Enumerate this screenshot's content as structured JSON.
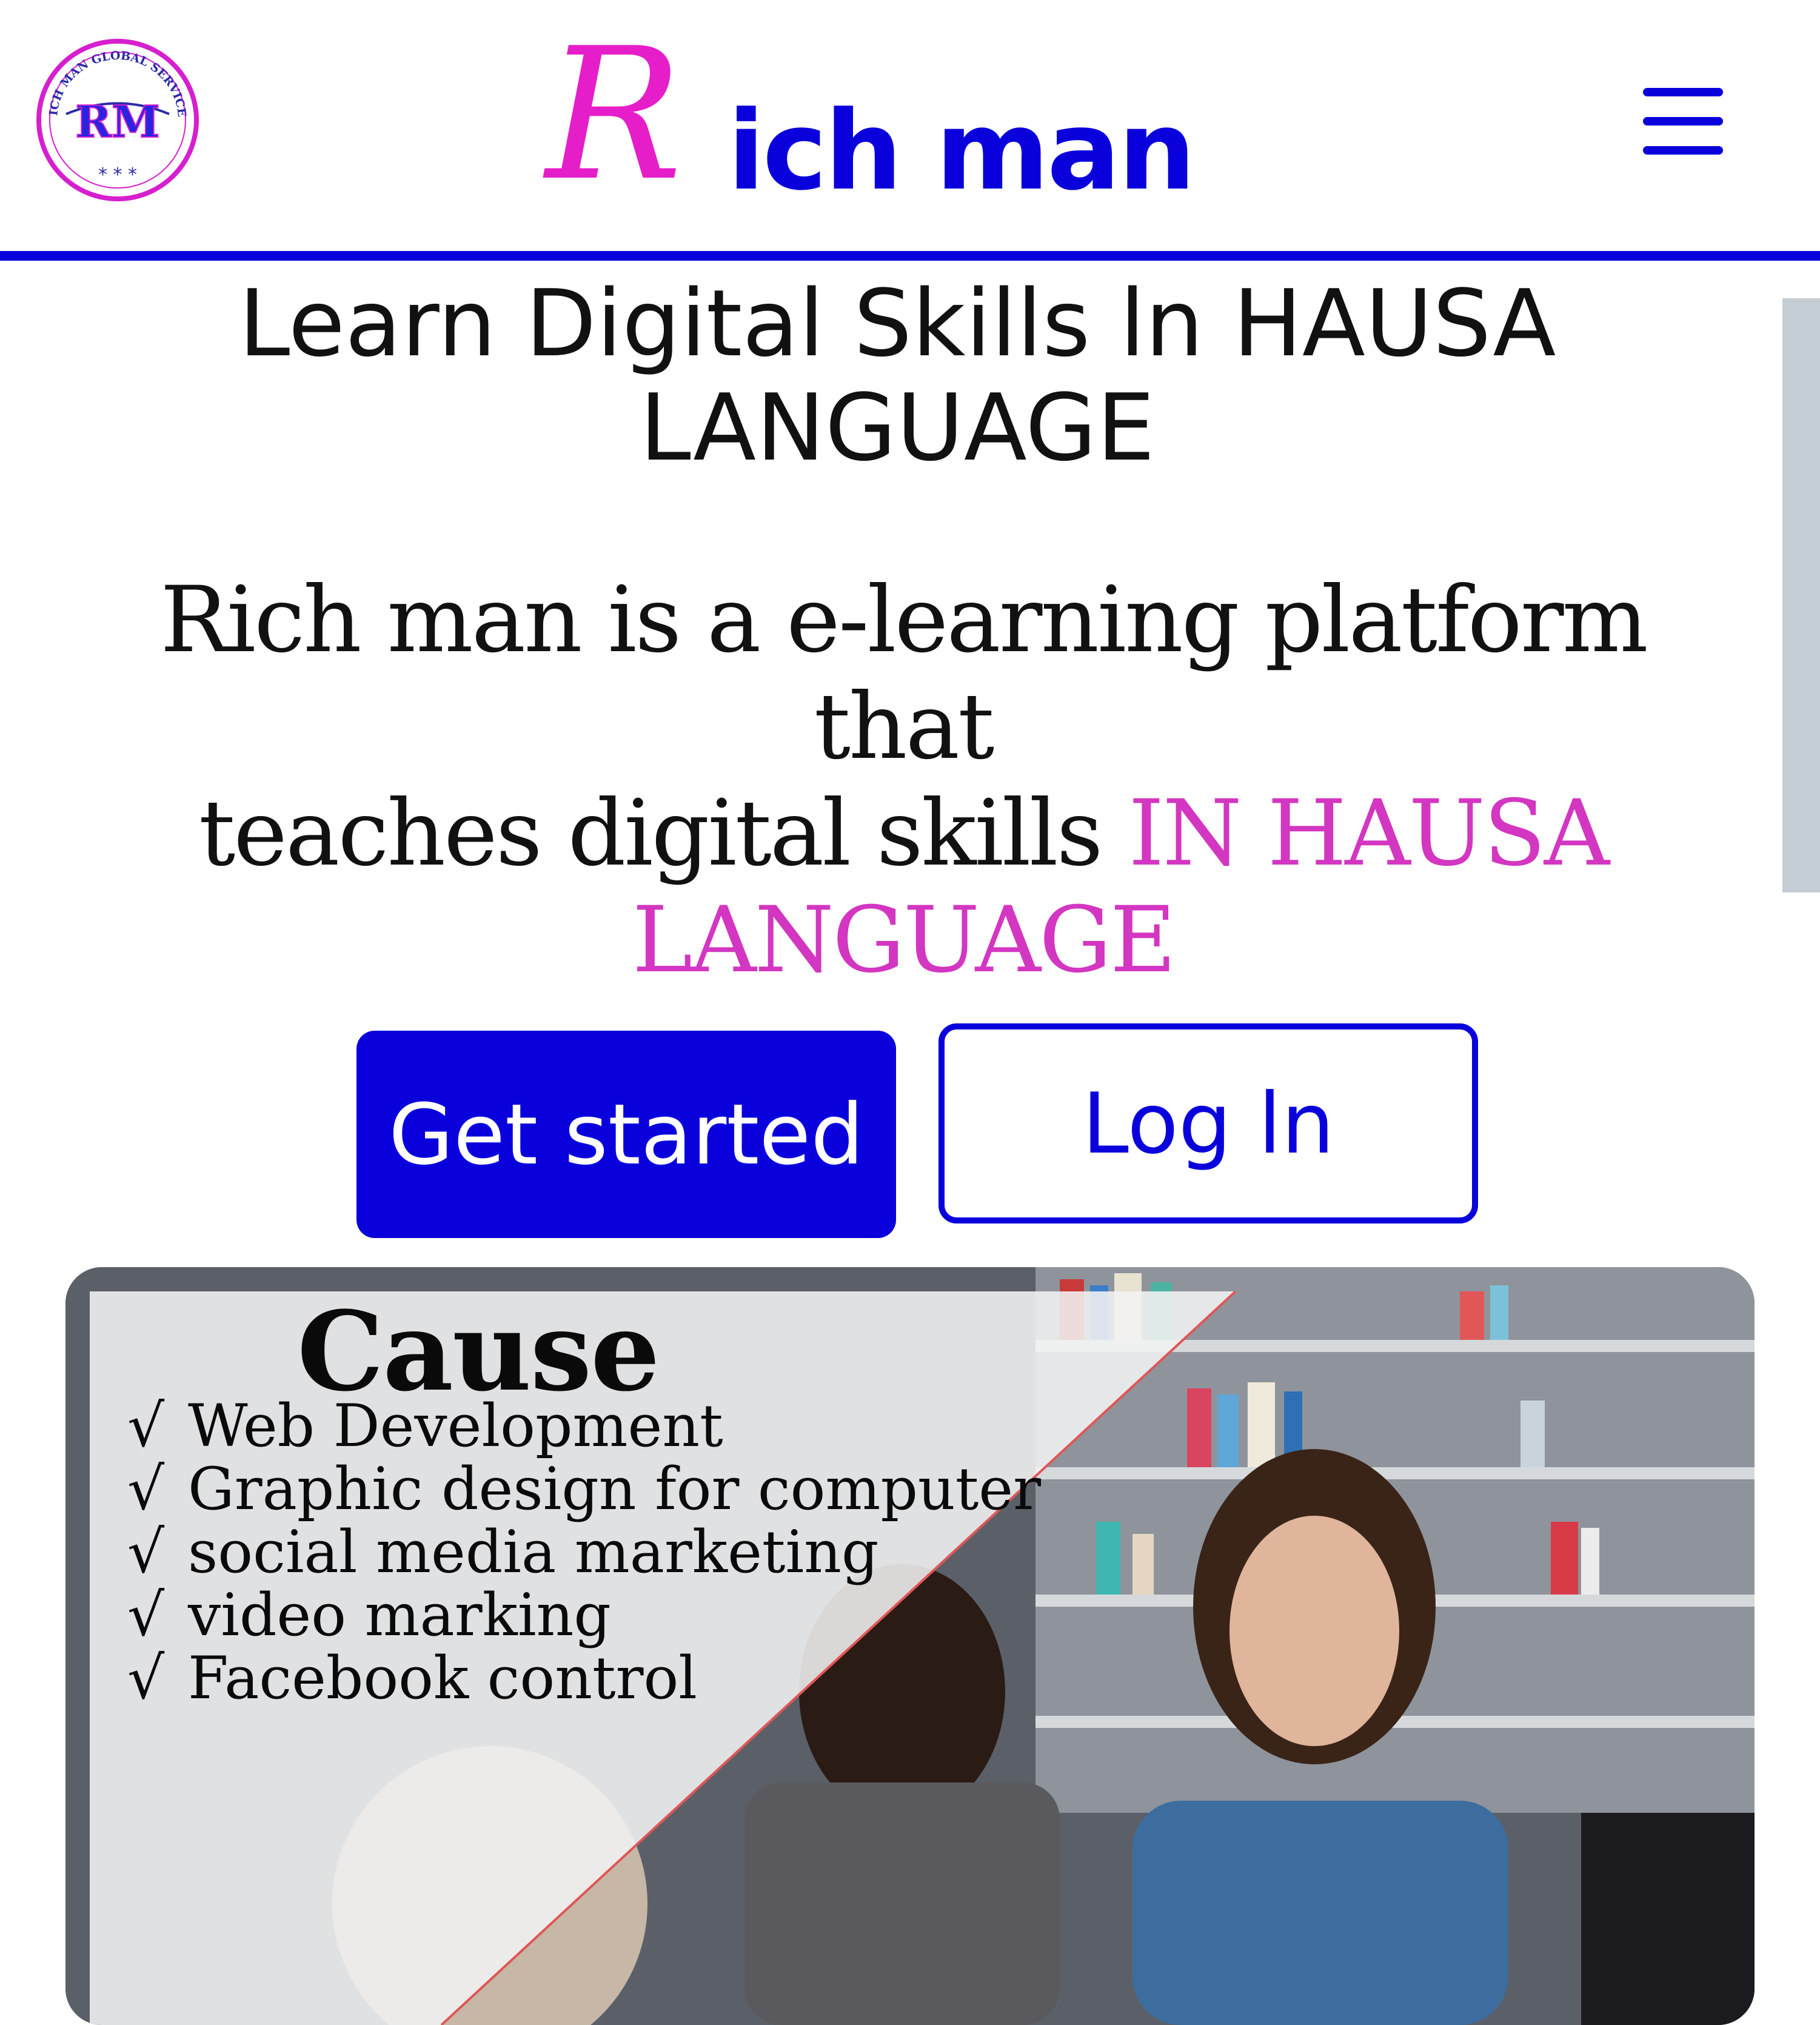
{
  "header": {
    "logo_badge_text": "RICH MAN GLOBAL SERVICES",
    "logo_monogram": "RM",
    "logo_stars": "* * *",
    "brand_initial": "R",
    "brand_rest": "ich man",
    "menu_icon": "hamburger-icon",
    "accent_color": "#0a00dc",
    "brand_pink": "#e61ec9"
  },
  "hero": {
    "headline_line1": "Learn Digital Skills ln HAUSA",
    "headline_line2": "LANGUAGE",
    "tagline_line1": "Rich man is a e-learning platform that",
    "tagline_line2_plain": "teaches digital skills ",
    "tagline_line2_accent": "IN HAUSA",
    "tagline_line3_accent": "LANGUAGE",
    "accent_text_color": "#d336c1"
  },
  "actions": {
    "get_started": "Get started",
    "log_in": "Log ln"
  },
  "promo": {
    "title": "Cause",
    "check_symbol": "√",
    "courses": [
      "Web Development",
      "Graphic design for computer",
      "social media marketing",
      "video marking",
      "Facebook control"
    ]
  }
}
